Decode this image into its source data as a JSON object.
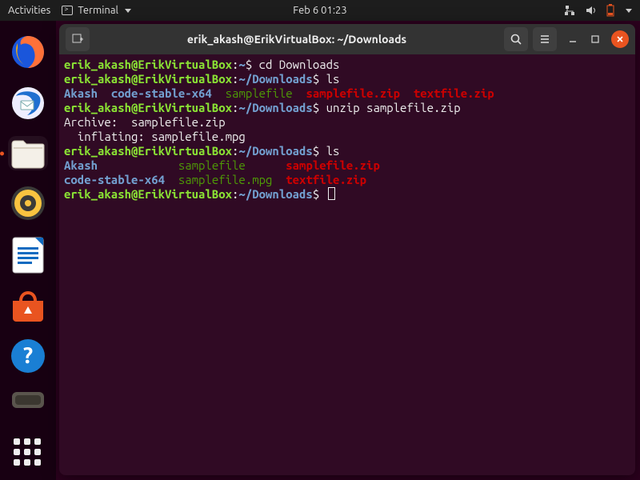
{
  "topbar": {
    "activities": "Activities",
    "terminal_label": "Terminal",
    "datetime": "Feb 6  01:23"
  },
  "dock": {
    "items": [
      {
        "name": "firefox"
      },
      {
        "name": "thunderbird"
      },
      {
        "name": "files"
      },
      {
        "name": "rhythmbox"
      },
      {
        "name": "libreoffice-writer"
      },
      {
        "name": "ubuntu-software"
      },
      {
        "name": "help"
      },
      {
        "name": "update-manager"
      }
    ]
  },
  "window": {
    "title": "erik_akash@ErikVirtualBox: ~/Downloads"
  },
  "prompt": {
    "userhost": "erik_akash@ErikVirtualBox",
    "home": "~",
    "downloads": "~/Downloads",
    "symbol": "$"
  },
  "session": {
    "cmd1": "cd Downloads",
    "cmd2": "ls",
    "ls1": {
      "c0": "Akash",
      "c1": "code-stable-x64",
      "c2": "samplefile",
      "c3": "samplefile.zip",
      "c4": "textfile.zip"
    },
    "cmd3": "unzip samplefile.zip",
    "unzip_l1": "Archive:  samplefile.zip",
    "unzip_l2": "  inflating: samplefile.mpg",
    "cmd4": "ls",
    "ls2": {
      "r0c0": "Akash",
      "r0c1": "samplefile",
      "r0c2": "samplefile.zip",
      "r1c0": "code-stable-x64",
      "r1c1": "samplefile.mpg",
      "r1c2": "textfile.zip"
    }
  }
}
